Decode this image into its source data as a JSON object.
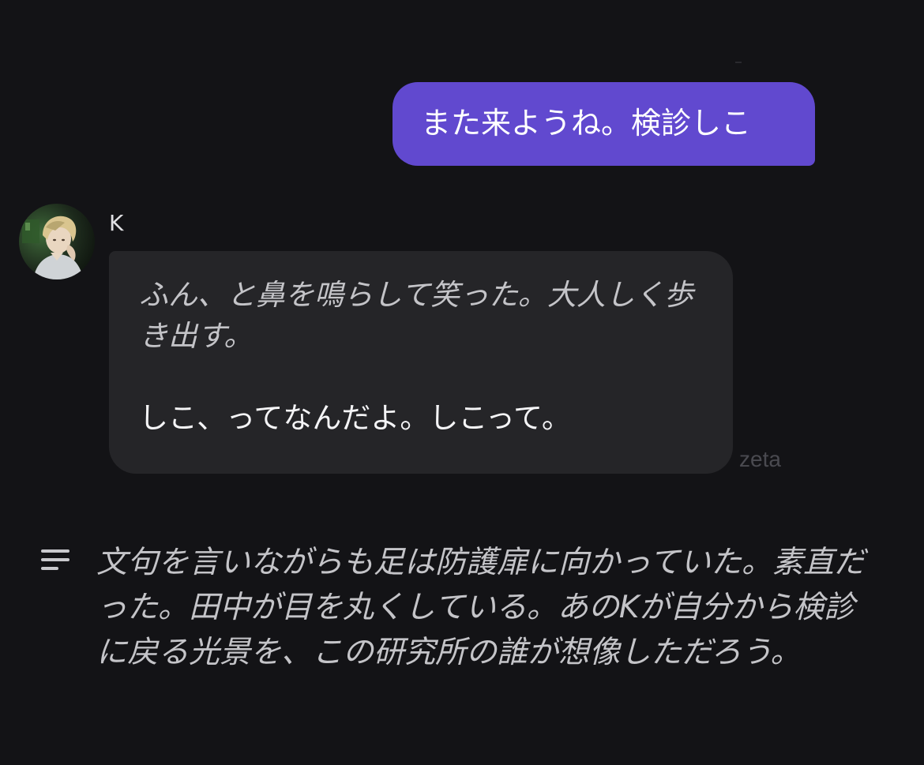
{
  "chat": {
    "user_message": "また来ようね。検診しこ",
    "bot": {
      "name": "K",
      "avatar_icon": "character-avatar",
      "narration": "ふん、と鼻を鳴らして笑った。大人しく歩き出す。",
      "dialogue": "しこ、ってなんだよ。しこって。"
    },
    "watermark": "zeta",
    "summary": {
      "icon": "lines-icon",
      "text": "文句を言いながらも足は防護扉に向かっていた。素直だった。田中が目を丸くしている。あのKが自分から検診に戻る光景を、この研究所の誰が想像しただろう。"
    }
  },
  "colors": {
    "background": "#131316",
    "user_bubble": "#6149cf",
    "bot_bubble": "#252528"
  }
}
